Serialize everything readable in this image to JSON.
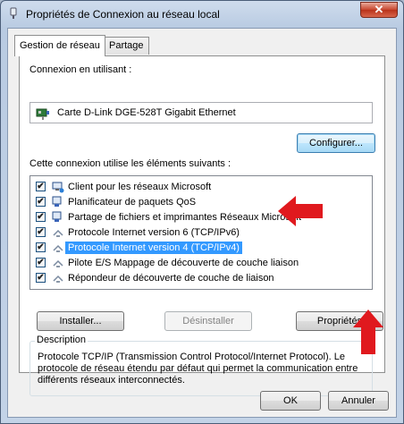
{
  "window": {
    "title": "Propriétés de Connexion au réseau local",
    "close_label": "✕"
  },
  "tabs": [
    {
      "label": "Gestion de réseau"
    },
    {
      "label": "Partage"
    }
  ],
  "connect_using": {
    "label": "Connexion en utilisant :",
    "adapter": "Carte D-Link DGE-528T Gigabit Ethernet",
    "configure_label": "Configurer..."
  },
  "items": {
    "label": "Cette connexion utilise les éléments suivants :",
    "list": [
      {
        "label": "Client pour les réseaux Microsoft",
        "checked": true,
        "icon": "client-icon"
      },
      {
        "label": "Planificateur de paquets QoS",
        "checked": true,
        "icon": "service-icon"
      },
      {
        "label": "Partage de fichiers et imprimantes Réseaux Microsoft",
        "checked": true,
        "icon": "service-icon"
      },
      {
        "label": "Protocole Internet version 6 (TCP/IPv6)",
        "checked": true,
        "icon": "protocol-icon"
      },
      {
        "label": "Protocole Internet version 4 (TCP/IPv4)",
        "checked": true,
        "icon": "protocol-icon",
        "selected": true
      },
      {
        "label": "Pilote E/S Mappage de découverte de couche liaison",
        "checked": true,
        "icon": "protocol-icon"
      },
      {
        "label": "Répondeur de découverte de couche de liaison",
        "checked": true,
        "icon": "protocol-icon"
      }
    ],
    "check_mark": "✔"
  },
  "actions": {
    "install": "Installer...",
    "uninstall": "Désinstaller",
    "properties": "Propriétés"
  },
  "description": {
    "title": "Description",
    "text": "Protocole TCP/IP (Transmission Control Protocol/Internet Protocol). Le protocole de réseau étendu par défaut qui permet la communication entre différents réseaux interconnectés."
  },
  "footer": {
    "ok": "OK",
    "cancel": "Annuler"
  },
  "colors": {
    "arrow": "#e0191e",
    "selection": "#3399ff"
  }
}
